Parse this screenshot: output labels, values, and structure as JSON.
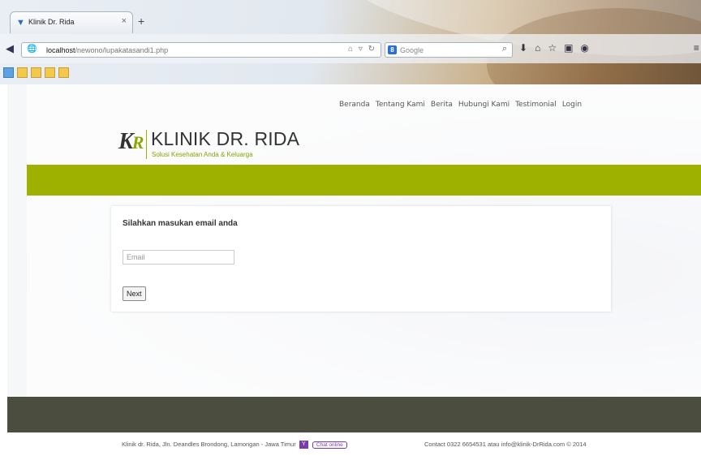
{
  "browser": {
    "tab_title": "Klinik Dr. Rida",
    "new_tab_label": "+",
    "url_host": "localhost",
    "url_path": "/newono/lupakatasandi1.php",
    "search_engine": "Google"
  },
  "site": {
    "nav": [
      "Beranda",
      "Tentang Kami",
      "Berita",
      "Hubungi Kami",
      "Testimonial",
      "Login"
    ],
    "logo_mark": "K",
    "logo_mark_r": "R",
    "name": "KLINIK DR. RIDA",
    "tagline": "Solusi Kesehatan Anda & Keluarga",
    "accent_color": "#9fb100"
  },
  "form": {
    "heading": "Silahkan masukan email anda",
    "email_placeholder": "Email",
    "next_label": "Next"
  },
  "footer": {
    "address": "Klinik dr. Rida, Jln. Deandles Brondong, Lamongan - Jawa Timur",
    "ym_label": "Y",
    "chat_label": "Chat online",
    "contact": "Contact 0322 6654531 atau info@klinik-DrRida.com © 2014"
  }
}
